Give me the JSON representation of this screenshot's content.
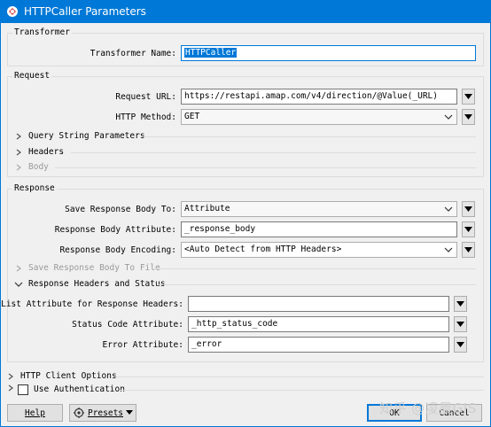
{
  "window": {
    "title": "HTTPCaller Parameters"
  },
  "transformer": {
    "group_title": "Transformer",
    "name_label": "Transformer Name:",
    "name_value": "HTTPCaller"
  },
  "request": {
    "group_title": "Request",
    "url_label": "Request URL:",
    "url_value": "https://restapi.amap.com/v4/direction/@Value(_URL)",
    "method_label": "HTTP Method:",
    "method_value": "GET",
    "query_string_label": "Query String Parameters",
    "headers_label": "Headers",
    "body_label": "Body"
  },
  "response": {
    "group_title": "Response",
    "save_to_label": "Save Response Body To:",
    "save_to_value": "Attribute",
    "body_attr_label": "Response Body Attribute:",
    "body_attr_value": "_response_body",
    "encoding_label": "Response Body Encoding:",
    "encoding_value": "<Auto Detect from HTTP Headers>",
    "save_file_label": "Save Response Body To File",
    "headers_status_label": "Response Headers and Status",
    "list_attr_label": "List Attribute for Response Headers:",
    "list_attr_value": "",
    "status_code_label": "Status Code Attribute:",
    "status_code_value": "_http_status_code",
    "error_attr_label": "Error Attribute:",
    "error_attr_value": "_error"
  },
  "http_client_options_label": "HTTP Client Options",
  "use_authentication_label": "Use Authentication",
  "use_authentication_checked": false,
  "buttons": {
    "help": "Help",
    "presets": "Presets",
    "ok": "OK",
    "cancel": "Cancel"
  },
  "watermark": "知乎 @凌晨GIS",
  "colors": {
    "titlebar": "#0078d7",
    "selection": "#0078d7"
  }
}
